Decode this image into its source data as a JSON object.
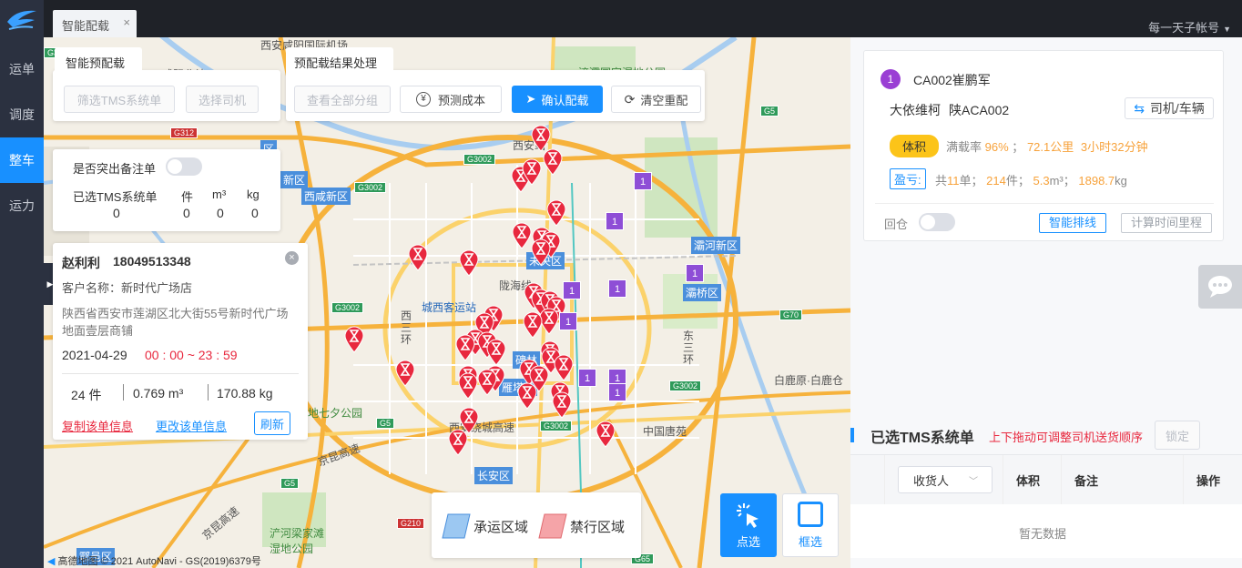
{
  "sidebar": {
    "logo": "bird-logo",
    "items": [
      {
        "label": "运单",
        "active": false
      },
      {
        "label": "调度",
        "active": false
      },
      {
        "label": "整车",
        "active": true
      },
      {
        "label": "运力",
        "active": false
      }
    ]
  },
  "topbar": {
    "tab_label": "智能配载",
    "close_glyph": "×",
    "account": "每一天子帐号"
  },
  "map_labels": {
    "places": [
      "西安咸阳国际机场",
      "浐灞国家湿地公园",
      "咸阳北站",
      "西安站",
      "城西客运站",
      "西咸新区",
      "未央区",
      "灞桥区",
      "灞河新区",
      "碑林",
      "雁塔区",
      "长安区",
      "陇海线",
      "白鹿原·白鹿仓",
      "中国唐苑",
      "浐河梁家滩湿地公园",
      "地七夕公园",
      "西安绕城高速",
      "京昆高速",
      "京昆高速",
      "西三环",
      "东三环",
      "区",
      "新区",
      "鄠邑区"
    ],
    "roads": [
      "G312",
      "G3002",
      "G3002",
      "G3002",
      "G3002",
      "G3002",
      "G5",
      "G5",
      "G5",
      "G70",
      "G210",
      "G65",
      "G30"
    ],
    "attribution": "高德地图 © 2021 AutoNavi - GS(2019)6379号"
  },
  "auto_panel": {
    "title": "智能预配载",
    "btn_filter": "筛选TMS系统单",
    "btn_driver": "选择司机"
  },
  "result_panel": {
    "title": "预配载结果处理",
    "btn_view_all": "查看全部分组",
    "btn_estimate": "预测成本",
    "btn_confirm": "确认配载",
    "btn_reset": "清空重配"
  },
  "summary_panel": {
    "highlight_label": "是否突出备注单",
    "selected_label": "已选TMS系统单",
    "col_pieces": "件",
    "col_volume": "m³",
    "col_weight": "kg",
    "selected_value": "0",
    "pieces_value": "0",
    "volume_value": "0",
    "weight_value": "0"
  },
  "popup": {
    "name": "赵利利",
    "phone": "18049513348",
    "customer": "客户名称：新时代广场店",
    "address": "陕西省西安市莲湖区北大街55号新时代广场地面壹层商铺",
    "date": "2021-04-29",
    "time_window": "00 : 00 ~ 23 : 59",
    "pieces": "24 件",
    "volume": "0.769 m³",
    "weight": "170.88 kg",
    "link_copy": "复制该单信息",
    "link_edit": "更改该单信息",
    "btn_refresh": "刷新"
  },
  "map_tools": {
    "legend_carrier": "承运区域",
    "legend_forbidden": "禁行区域",
    "btn_point_select": "点选",
    "btn_box_select": "框选"
  },
  "right_panel": {
    "card": {
      "index": "1",
      "vehicle": "CA002崔鹏军",
      "company": "大依维柯",
      "plate": "陕ACA002",
      "driver_btn": "司机/车辆",
      "tag_volume": "体积",
      "load_label": "满载率",
      "load_rate": "96%",
      "sep": "；",
      "distance": "72.1公里",
      "duration": "3小时32分钟",
      "tag_profit": "盈亏",
      "orders_prefix": "共",
      "orders_count": "11",
      "orders_suffix": "单；",
      "pieces_count": "214",
      "pieces_suffix": "件；",
      "volume_value": "5.3",
      "volume_unit": "m³；",
      "weight_value": "1898.7",
      "weight_unit": "kg",
      "return_label": "回仓",
      "btn_route": "智能排线",
      "btn_calc": "计算时间里程"
    },
    "selected": {
      "title": "已选TMS系统单",
      "hint": "上下拖动可调整司机送货顺序",
      "btn_lock": "锁定",
      "col_receiver": "收货人",
      "col_volume": "体积",
      "col_remark": "备注",
      "col_action": "操作",
      "empty": "暂无数据"
    }
  },
  "colors": {
    "sidebar_bg": "#2b3140",
    "primary": "#1890ff",
    "marker_red": "#e8283e",
    "cluster_purple": "#8e4ed6",
    "accent_orange": "#f7a23b"
  },
  "markers": {
    "count": 40,
    "cluster_labels": [
      "1",
      "1",
      "1",
      "1",
      "1",
      "1",
      "1",
      "1",
      "1"
    ]
  }
}
